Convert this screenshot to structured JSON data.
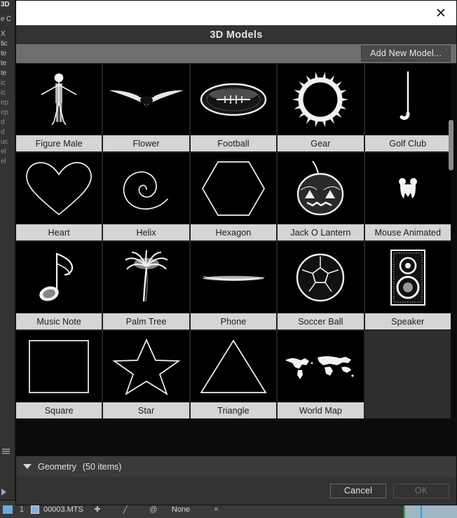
{
  "dialog": {
    "title": "3D Models",
    "close_icon": "close-icon",
    "toolbar": {
      "add_new_model_label": "Add New Model..."
    },
    "category": {
      "label": "Geometry",
      "count_label": "(50 items)",
      "expander_icon": "triangle-down-icon"
    },
    "buttons": {
      "cancel_label": "Cancel",
      "ok_label": "OK"
    }
  },
  "models": [
    {
      "label": "Figure Male",
      "icon": "figure-male-icon"
    },
    {
      "label": "Flower",
      "icon": "flower-icon"
    },
    {
      "label": "Football",
      "icon": "football-icon"
    },
    {
      "label": "Gear",
      "icon": "gear-icon"
    },
    {
      "label": "Golf Club",
      "icon": "golf-club-icon"
    },
    {
      "label": "Heart",
      "icon": "heart-icon"
    },
    {
      "label": "Helix",
      "icon": "helix-icon"
    },
    {
      "label": "Hexagon",
      "icon": "hexagon-icon"
    },
    {
      "label": "Jack O Lantern",
      "icon": "jack-o-lantern-icon"
    },
    {
      "label": "Mouse Animated",
      "icon": "mouse-animated-icon"
    },
    {
      "label": "Music Note",
      "icon": "music-note-icon"
    },
    {
      "label": "Palm Tree",
      "icon": "palm-tree-icon"
    },
    {
      "label": "Phone",
      "icon": "phone-icon"
    },
    {
      "label": "Soccer Ball",
      "icon": "soccer-ball-icon"
    },
    {
      "label": "Speaker",
      "icon": "speaker-icon"
    },
    {
      "label": "Square",
      "icon": "square-icon"
    },
    {
      "label": "Star",
      "icon": "star-icon"
    },
    {
      "label": "Triangle",
      "icon": "triangle-icon"
    },
    {
      "label": "World Map",
      "icon": "world-map-icon"
    }
  ],
  "background": {
    "left_panel_lines": [
      "3D",
      "e C",
      "X",
      "tic",
      "te",
      "te",
      "te",
      "ic",
      "ic",
      "ep",
      "ep",
      "d",
      "d",
      "uc",
      "el",
      "el"
    ],
    "timeline": {
      "track_number": "1",
      "clip_name": "00003.MTS",
      "effect_label": "None",
      "at_icon": "at-icon",
      "close_icon": "close-icon"
    }
  },
  "colors": {
    "dialog_bg": "#2e2e2e",
    "header_bg": "#333333",
    "toolbar_bg": "#6e6e6e",
    "thumb_bg": "#000000",
    "label_bg": "#d5d5d5",
    "titlebar_bg": "#ffffff",
    "scrollbar": "#8a8a8a"
  }
}
